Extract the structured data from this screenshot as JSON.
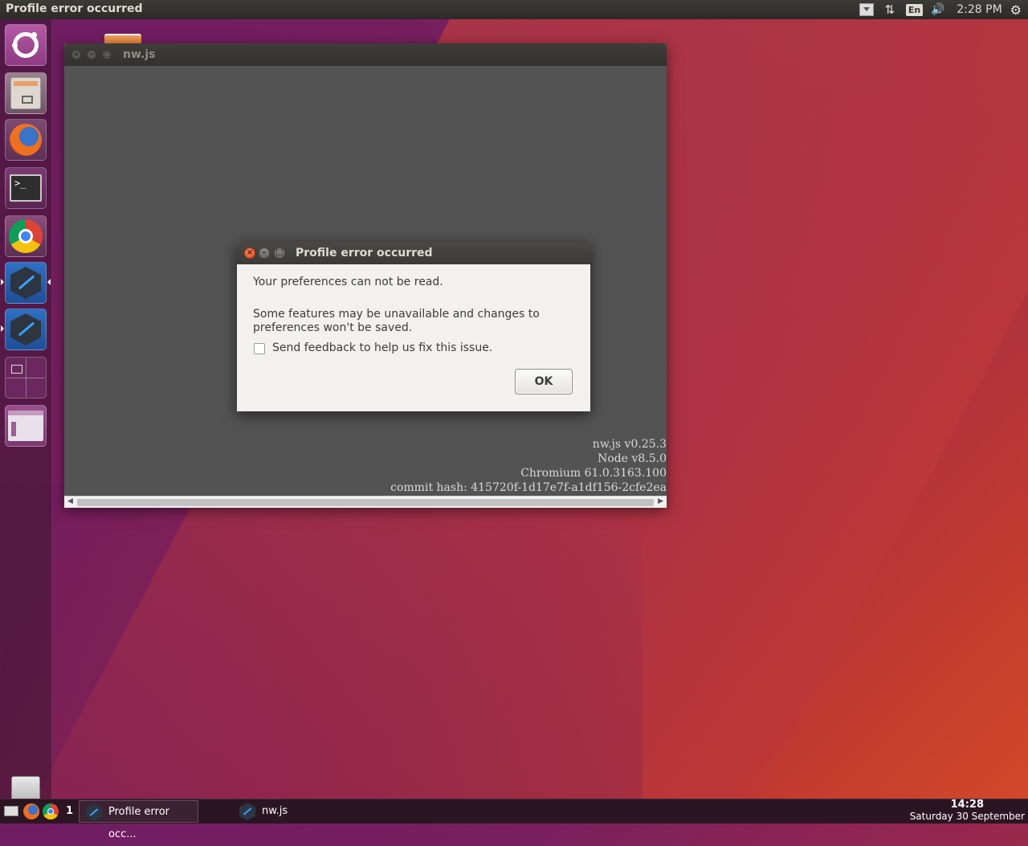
{
  "top_panel": {
    "active_title": "Profile error occurred",
    "language": "En",
    "time": "2:28 PM"
  },
  "launcher": {
    "items": [
      {
        "name": "ubuntu-dash"
      },
      {
        "name": "files"
      },
      {
        "name": "firefox"
      },
      {
        "name": "terminal"
      },
      {
        "name": "chrome"
      },
      {
        "name": "nwjs"
      },
      {
        "name": "nwjs"
      },
      {
        "name": "workspace-switcher"
      },
      {
        "name": "app"
      },
      {
        "name": "trash"
      }
    ]
  },
  "nw_window": {
    "title": "nw.js",
    "version_lines": [
      "nw.js v0.25.3",
      "Node v8.5.0",
      "Chromium 61.0.3163.100",
      "commit hash: 415720f-1d17e7f-a1df156-2cfe2ea"
    ]
  },
  "dialog": {
    "title": "Profile error occurred",
    "message_1": "Your preferences can not be read.",
    "message_2": "Some features may be unavailable and changes to preferences won't be saved.",
    "checkbox_label": "Send feedback to help us fix this issue.",
    "checkbox_checked": false,
    "ok_label": "OK"
  },
  "taskbar": {
    "workspace_number": "1",
    "items": [
      {
        "label": "Profile error occ..."
      },
      {
        "label": "nw.js"
      }
    ],
    "clock_time": "14:28",
    "clock_date": "Saturday 30 September"
  }
}
